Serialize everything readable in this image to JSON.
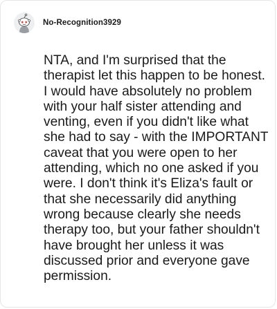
{
  "comment": {
    "author": "No-Recognition3929",
    "avatar_icon": "reddit-snoo-avatar-icon",
    "body": "NTA, and I'm surprised that the therapist let this happen to be honest. I would have absolutely no problem with your half sister attending and venting, even if you didn't like what she had to say - with the IMPORTANT caveat that you were open to her attending, which no one asked if you were. I don't think it's Eliza's fault or that she necessarily did anything wrong because clearly she needs therapy too, but your father shouldn't have brought her unless it was discussed prior and everyone gave permission."
  }
}
